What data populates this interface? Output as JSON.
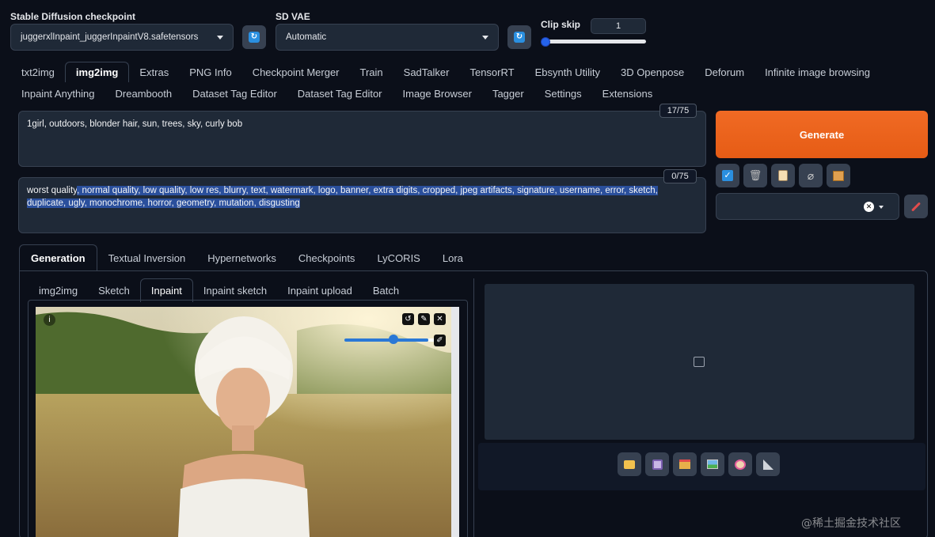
{
  "settings": {
    "checkpoint_label": "Stable Diffusion checkpoint",
    "checkpoint_value": "juggerxlInpaint_juggerInpaintV8.safetensors",
    "vae_label": "SD VAE",
    "vae_value": "Automatic",
    "clip_label": "Clip skip",
    "clip_value": "1",
    "refresh_icon": "refresh-icon"
  },
  "main_tabs_row1": [
    "txt2img",
    "img2img",
    "Extras",
    "PNG Info",
    "Checkpoint Merger",
    "Train",
    "SadTalker",
    "TensorRT",
    "Ebsynth Utility",
    "3D Openpose",
    "Deforum",
    "Infinite image browsing"
  ],
  "main_tabs_row2": [
    "Inpaint Anything",
    "Dreambooth",
    "Dataset Tag Editor",
    "Dataset Tag Editor",
    "Image Browser",
    "Tagger",
    "Settings",
    "Extensions"
  ],
  "prompt": {
    "text": "1girl, outdoors, blonder hair, sun, trees, sky, curly bob",
    "counter": "17/75"
  },
  "negative_prompt": {
    "text_start": "worst quality",
    "text_selected": ", normal quality, low quality, low res, blurry, text, watermark, logo, banner, extra digits, cropped, jpeg artifacts, signature, username, error, sketch, duplicate, ugly, monochrome, horror, geometry, mutation, disgusting",
    "counter": "0/75"
  },
  "generate_label": "Generate",
  "tools": [
    "checkbox-icon",
    "trash-icon",
    "clipboard-icon",
    "paperclip-icon",
    "box-icon"
  ],
  "style_clear": "✕",
  "gen_tabs": [
    "Generation",
    "Textual Inversion",
    "Hypernetworks",
    "Checkpoints",
    "LyCORIS",
    "Lora"
  ],
  "img_tabs": [
    "img2img",
    "Sketch",
    "Inpaint",
    "Inpaint sketch",
    "Inpaint upload",
    "Batch"
  ],
  "output_buttons": [
    "folder-icon",
    "save-icon",
    "zip-icon",
    "image-icon",
    "palette-icon",
    "ruler-icon"
  ],
  "watermark": "@稀土掘金技术社区",
  "colors": {
    "accent": "#f06a24",
    "bg": "#0b0f19",
    "panel": "#1f2937",
    "selection": "#2a4f9c"
  }
}
